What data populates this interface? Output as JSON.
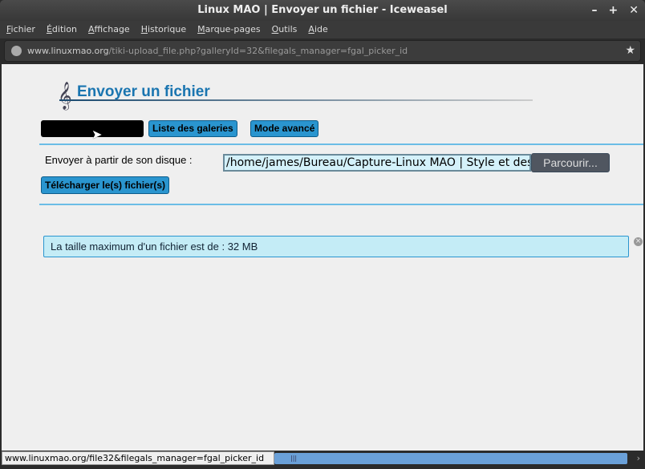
{
  "window": {
    "title": "Linux MAO | Envoyer un fichier - Iceweasel",
    "controls": [
      "–",
      "+",
      "✕"
    ]
  },
  "menu": [
    "Fichier",
    "Édition",
    "Affichage",
    "Historique",
    "Marque-pages",
    "Outils",
    "Aide"
  ],
  "url": {
    "domain": "www.linuxmao.org",
    "path": "/tiki-upload_file.php?galleryId=32&filegals_manager=fgal_picker_id"
  },
  "page": {
    "title": "Envoyer un fichier",
    "buttons": {
      "galleries": "Liste des galeries",
      "advanced": "Mode avancé",
      "upload": "Télécharger le(s) fichier(s)",
      "browse": "Parcourir..."
    },
    "upload_label": "Envoyer à partir de son disque :",
    "file_value": "/home/james/Bureau/Capture-Linux MAO | Style et desi",
    "info": "La taille maximum d'un fichier est de : 32 MB"
  },
  "status": "www.linuxmao.org/file32&filegals_manager=fgal_picker_id"
}
